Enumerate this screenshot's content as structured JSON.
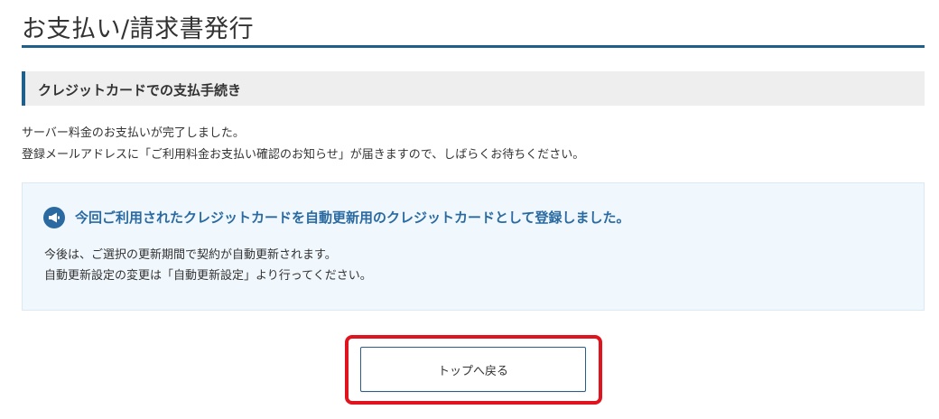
{
  "page": {
    "title": "お支払い/請求書発行"
  },
  "section": {
    "header": "クレジットカードでの支払手続き"
  },
  "message": {
    "line1": "サーバー料金のお支払いが完了しました。",
    "line2": "登録メールアドレスに「ご利用料金お支払い確認のお知らせ」が届きますので、しばらくお待ちください。"
  },
  "info": {
    "icon": "megaphone-icon",
    "heading": "今回ご利用されたクレジットカードを自動更新用のクレジットカードとして登録しました。",
    "line1": "今後は、ご選択の更新期間で契約が自動更新されます。",
    "line2": "自動更新設定の変更は「自動更新設定」より行ってください。"
  },
  "actions": {
    "top_button_label": "トップへ戻る"
  },
  "colors": {
    "accent": "#1f5f8b",
    "info_text": "#2a6aa0",
    "highlight": "#e0141e",
    "info_bg": "#f0f7fd"
  }
}
